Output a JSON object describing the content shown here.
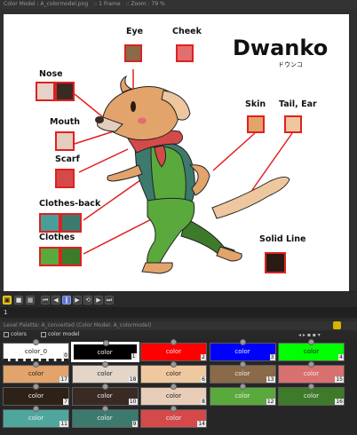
{
  "titlebar": {
    "color_model": "Color Model : A_colormodel.png",
    "frame": ":: 1 Frame",
    "zoom": ":: Zoom : 79 %"
  },
  "canvas": {
    "title": "Dwanko",
    "subtitle": "ドウンコ",
    "labels": {
      "eye": "Eye",
      "cheek": "Cheek",
      "nose": "Nose",
      "mouth": "Mouth",
      "scarf": "Scarf",
      "clothes_back": "Clothes-back",
      "clothes": "Clothes",
      "skin": "Skin",
      "tail_ear": "Tail, Ear",
      "solid_line": "Solid Line"
    },
    "colors": {
      "eye": "#8a6a48",
      "cheek": "#e26f6f",
      "nose_light": "#e5d2c8",
      "nose_dark": "#3a2a24",
      "mouth": "#e3cdbf",
      "scarf": "#d44a4a",
      "clothes_back_a": "#4a9e9a",
      "clothes_back_b": "#3d7a6e",
      "clothes_a": "#5aa93c",
      "clothes_b": "#3d7a2a",
      "skin": "#e2a46a",
      "tail_ear": "#eec79f",
      "solid_line": "#2a1a14"
    }
  },
  "framebar": {
    "frame_value": "1"
  },
  "palette": {
    "header": "Level Palette: A_converted",
    "header_model": "(Color Model: A_colormodel)",
    "tab_colors": "colors",
    "tab_model": "color model",
    "chips": [
      {
        "name": "color_0",
        "num": "0",
        "color": "#ffffff"
      },
      {
        "name": "color",
        "num": "1",
        "color": "#000000"
      },
      {
        "name": "color",
        "num": "2",
        "color": "#ff0000"
      },
      {
        "name": "color",
        "num": "3",
        "color": "#0000ff"
      },
      {
        "name": "color",
        "num": "4",
        "color": "#00ff00"
      },
      {
        "name": "color",
        "num": "17",
        "color": "#e2a46a"
      },
      {
        "name": "color",
        "num": "18",
        "color": "#e3d5c8"
      },
      {
        "name": "color",
        "num": "6",
        "color": "#f0c8a0"
      },
      {
        "name": "color",
        "num": "13",
        "color": "#8a6a48"
      },
      {
        "name": "color",
        "num": "15",
        "color": "#d97070"
      },
      {
        "name": "color",
        "num": "7",
        "color": "#2e2218"
      },
      {
        "name": "color",
        "num": "10",
        "color": "#3a2a24"
      },
      {
        "name": "color",
        "num": "8",
        "color": "#e8cdb8"
      },
      {
        "name": "color",
        "num": "12",
        "color": "#5aa93c"
      },
      {
        "name": "color",
        "num": "16",
        "color": "#3d7a2a"
      },
      {
        "name": "color",
        "num": "11",
        "color": "#4fa69c"
      },
      {
        "name": "color",
        "num": "9",
        "color": "#3d7a6e"
      },
      {
        "name": "color",
        "num": "14",
        "color": "#d44a4a"
      }
    ]
  }
}
